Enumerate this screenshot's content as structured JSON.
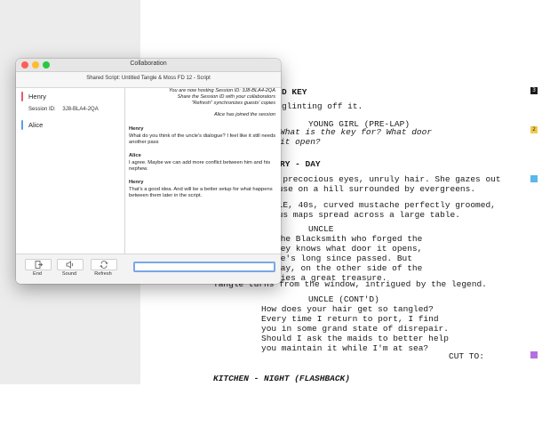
{
  "script": {
    "lines": [
      "D KEY",
      "glinting off it.",
      "YOUNG GIRL (PRE-LAP)",
      "What is the key for? What door",
      "it open?",
      "RY - DAY",
      ", precocious eyes, unruly hair. She gazes out",
      "ouse on a hill surrounded by evergreens.",
      "CLE, 40s, curved mustache perfectly groomed,",
      "ous maps spread across a large table.",
      "UNCLE",
      "the Blacksmith who forged the",
      "key knows what door it opens,",
      "he's long since passed. But",
      "say, on the other side of the",
      "lies a great treasure.",
      "Tangle turns from the window, intrigued by the legend.",
      "UNCLE (CONT'D)",
      "How does your hair get so tangled?",
      "Every time I return to port, I find",
      "you in some grand state of disrepair.",
      "Should I ask the maids to better help",
      "you maintain it while I'm at sea?",
      "CUT TO:",
      "KITCHEN - NIGHT (FLASHBACK)"
    ],
    "markers": [
      "3",
      "2",
      "",
      ""
    ]
  },
  "colors": {
    "marker_black": "#1a1a1a",
    "marker_yellow": "#f2c94c",
    "marker_blue": "#5ab7e8",
    "marker_purple": "#b56fe0",
    "henry": "#e8596b",
    "alice": "#5aa0e6"
  },
  "window": {
    "title": "Collaboration",
    "subtitle": "Shared Script: Untitled Tangle & Moss FD 12 - Script",
    "users": [
      {
        "name": "Henry"
      },
      {
        "name": "Alice"
      }
    ],
    "session_label": "Session ID:",
    "session_value": "3J8-BLA4-2QA",
    "system_messages": [
      "You are now hosting Session ID: 3J8-BLA4-2QA",
      "Share the Session ID with your collaborators",
      "\"Refresh\" synchronizes guests' copies",
      "Alice has joined the session"
    ],
    "messages": [
      {
        "author": "Henry",
        "text": "What do you think of the uncle's dialogue? I feel like it still needs another pass"
      },
      {
        "author": "Alice",
        "text": "I agree. Maybe we can add more conflict between him and his nephew."
      },
      {
        "author": "Henry",
        "text": "That's a good idea. And will be a better setup for what happens between them later in the script."
      }
    ],
    "buttons": [
      {
        "label": "End",
        "icon": "end-session-icon"
      },
      {
        "label": "Sound",
        "icon": "speaker-icon"
      },
      {
        "label": "Refresh",
        "icon": "refresh-icon"
      }
    ],
    "chat_input": {
      "value": "",
      "placeholder": ""
    }
  }
}
